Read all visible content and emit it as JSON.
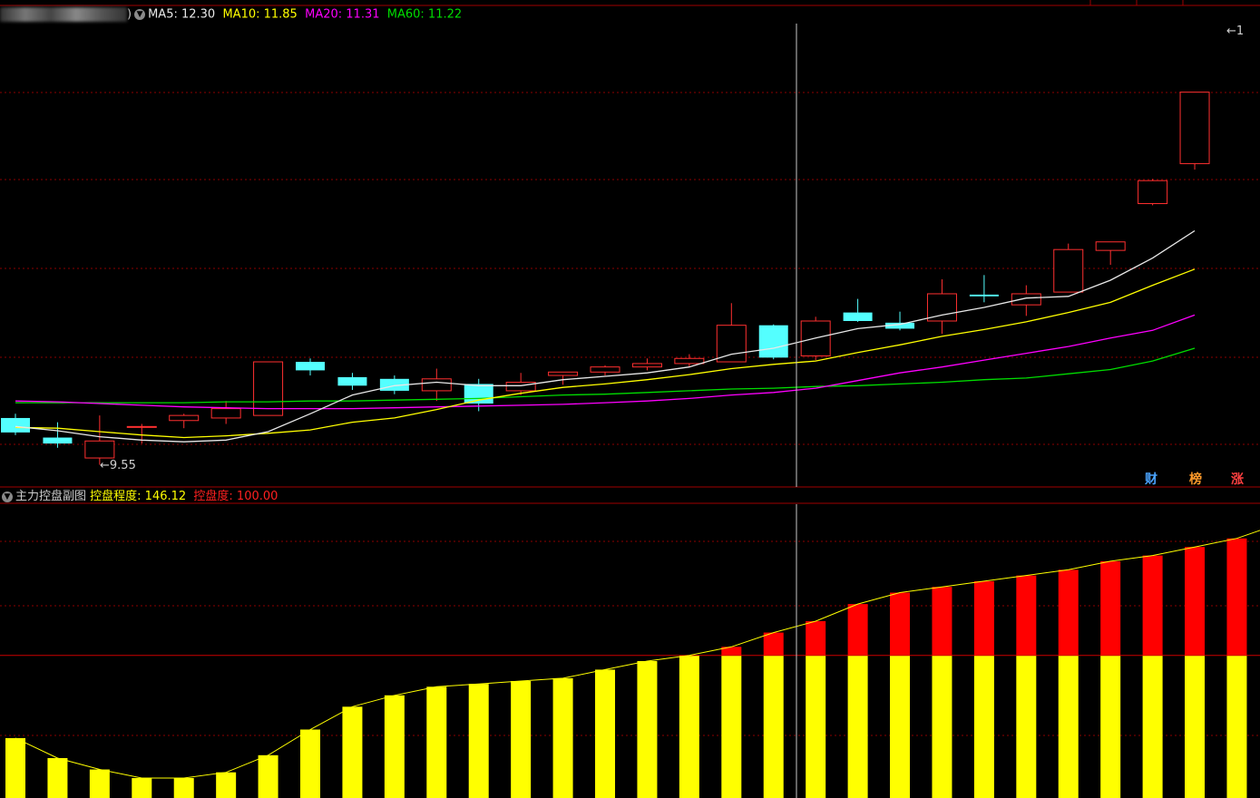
{
  "colors": {
    "ma5": "#e8e8e8",
    "ma10": "#ffff00",
    "ma20": "#ff00ff",
    "ma60": "#00dd00",
    "up": "#ff3030",
    "down": "#54ffff",
    "grid": "#8b0000",
    "bar_low": "#ffff00",
    "bar_high": "#ff0000",
    "sub_line": "#ffff00",
    "cursor": "#c8c8c8"
  },
  "main_header": {
    "name_suffix": ")",
    "ma5_label": "MA5: 12.30",
    "ma10_label": "MA10: 11.85",
    "ma20_label": "MA20: 11.31",
    "ma60_label": "MA60: 11.22"
  },
  "sub_header": {
    "title": "主力控盘副图",
    "degree_label": "控盘程度: 146.12",
    "control_label": "控盘度: 100.00"
  },
  "min_marker": "←9.55",
  "max_marker": "←1",
  "badges": {
    "cai": "财",
    "bang": "榜",
    "zhang": "涨"
  },
  "chart_data": [
    {
      "type": "candlestick",
      "price_range": [
        9.3,
        14.8
      ],
      "candles": [
        {
          "o": 10.1,
          "h": 10.15,
          "c": 9.93,
          "l": 9.9
        },
        {
          "o": 9.87,
          "h": 10.05,
          "c": 9.8,
          "l": 9.75
        },
        {
          "o": 9.63,
          "h": 10.13,
          "c": 9.83,
          "l": 9.55
        },
        {
          "o": 10.0,
          "h": 10.03,
          "c": 10.0,
          "l": 9.8
        },
        {
          "o": 10.07,
          "h": 10.15,
          "c": 10.13,
          "l": 9.98
        },
        {
          "o": 10.1,
          "h": 10.3,
          "c": 10.21,
          "l": 10.03
        },
        {
          "o": 10.13,
          "h": 10.76,
          "c": 10.76,
          "l": 10.13
        },
        {
          "o": 10.76,
          "h": 10.8,
          "c": 10.66,
          "l": 10.6
        },
        {
          "o": 10.58,
          "h": 10.63,
          "c": 10.48,
          "l": 10.43
        },
        {
          "o": 10.56,
          "h": 10.6,
          "c": 10.42,
          "l": 10.38
        },
        {
          "o": 10.42,
          "h": 10.68,
          "c": 10.56,
          "l": 10.3
        },
        {
          "o": 10.5,
          "h": 10.56,
          "c": 10.27,
          "l": 10.18
        },
        {
          "o": 10.42,
          "h": 10.63,
          "c": 10.52,
          "l": 10.37
        },
        {
          "o": 10.6,
          "h": 10.63,
          "c": 10.64,
          "l": 10.49
        },
        {
          "o": 10.64,
          "h": 10.72,
          "c": 10.7,
          "l": 10.6
        },
        {
          "o": 10.7,
          "h": 10.8,
          "c": 10.74,
          "l": 10.66
        },
        {
          "o": 10.74,
          "h": 10.85,
          "c": 10.8,
          "l": 10.7
        },
        {
          "o": 10.76,
          "h": 11.45,
          "c": 11.19,
          "l": 10.76
        },
        {
          "o": 11.19,
          "h": 11.2,
          "c": 10.81,
          "l": 10.79
        },
        {
          "o": 10.83,
          "h": 11.29,
          "c": 11.24,
          "l": 10.78
        },
        {
          "o": 11.34,
          "h": 11.5,
          "c": 11.24,
          "l": 11.23
        },
        {
          "o": 11.22,
          "h": 11.35,
          "c": 11.15,
          "l": 11.13
        },
        {
          "o": 11.24,
          "h": 11.73,
          "c": 11.56,
          "l": 11.09
        },
        {
          "o": 11.55,
          "h": 11.78,
          "c": 11.53,
          "l": 11.46
        },
        {
          "o": 11.43,
          "h": 11.66,
          "c": 11.56,
          "l": 11.3
        },
        {
          "o": 11.58,
          "h": 12.15,
          "c": 12.08,
          "l": 11.58
        },
        {
          "o": 12.07,
          "h": 12.13,
          "c": 12.17,
          "l": 11.9
        },
        {
          "o": 12.62,
          "h": 12.91,
          "c": 12.89,
          "l": 12.6
        },
        {
          "o": 13.09,
          "h": 13.93,
          "c": 13.93,
          "l": 13.02
        }
      ],
      "ma5": [
        10.0,
        9.95,
        9.88,
        9.84,
        9.82,
        9.84,
        9.94,
        10.15,
        10.37,
        10.48,
        10.52,
        10.48,
        10.48,
        10.55,
        10.59,
        10.63,
        10.7,
        10.85,
        10.92,
        11.04,
        11.15,
        11.2,
        11.31,
        11.4,
        11.51,
        11.53,
        11.72,
        11.98,
        12.3
      ],
      "ma10": [
        9.99,
        9.98,
        9.94,
        9.9,
        9.87,
        9.89,
        9.92,
        9.96,
        10.05,
        10.1,
        10.2,
        10.31,
        10.39,
        10.46,
        10.5,
        10.55,
        10.61,
        10.68,
        10.73,
        10.77,
        10.87,
        10.96,
        11.06,
        11.14,
        11.23,
        11.34,
        11.46,
        11.66,
        11.85
      ],
      "ma20": [
        10.3,
        10.29,
        10.27,
        10.25,
        10.23,
        10.22,
        10.21,
        10.21,
        10.21,
        10.22,
        10.23,
        10.24,
        10.25,
        10.26,
        10.28,
        10.3,
        10.33,
        10.37,
        10.4,
        10.45,
        10.54,
        10.63,
        10.7,
        10.78,
        10.86,
        10.94,
        11.04,
        11.13,
        11.31
      ],
      "ma60": [
        10.28,
        10.28,
        10.28,
        10.28,
        10.28,
        10.29,
        10.29,
        10.3,
        10.3,
        10.31,
        10.32,
        10.33,
        10.35,
        10.37,
        10.38,
        10.4,
        10.42,
        10.44,
        10.45,
        10.47,
        10.48,
        10.5,
        10.52,
        10.55,
        10.57,
        10.62,
        10.67,
        10.77,
        10.92
      ]
    },
    {
      "type": "bar",
      "title": "主力控盘副图",
      "threshold": 100,
      "value_range": [
        50,
        153
      ],
      "values": [
        71,
        64,
        60,
        57,
        57,
        59,
        65,
        74,
        82,
        86,
        89,
        90,
        91,
        92,
        95,
        98,
        100,
        103,
        108,
        112,
        118,
        122,
        124,
        126,
        128,
        130,
        133,
        135,
        138,
        141,
        146.12
      ]
    }
  ]
}
